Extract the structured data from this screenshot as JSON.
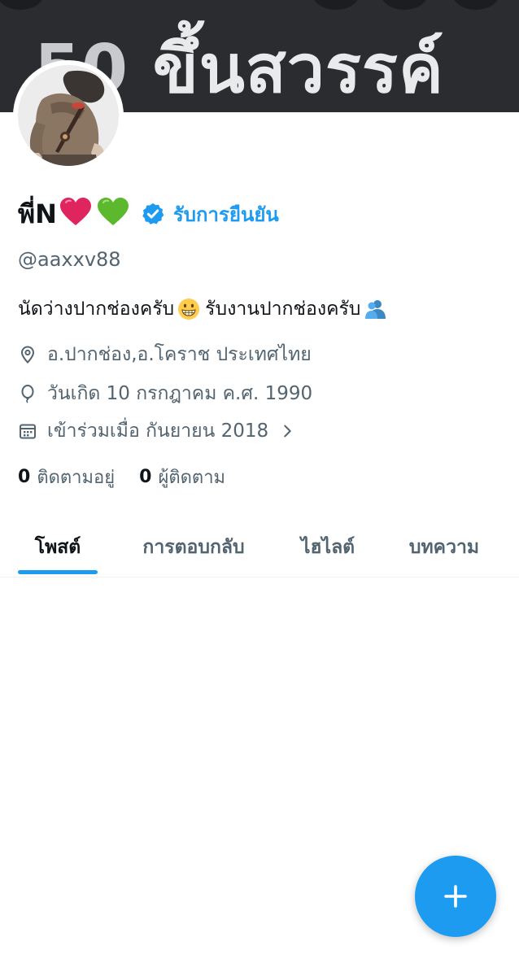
{
  "banner": {
    "number_text": "50",
    "text": "ขึ้นสวรรค์"
  },
  "profile": {
    "display_name": "พี่N",
    "heart_red_icon": "red-heart-emoji",
    "heart_green_icon": "green-heart-emoji",
    "verify_link": "รับการยืนยัน",
    "handle": "@aaxxv88",
    "bio_part1": "นัดว่างปากช่องครับ",
    "bio_emoji1": "grinning-face-emoji",
    "bio_part2": "รับงานปากช่องครับ",
    "bio_emoji2": "people-hugging-emoji",
    "location": "อ.ปากช่อง,อ.โคราช ประเทศไทย",
    "birthday": "วันเกิด 10 กรกฎาคม ค.ศ. 1990",
    "joined": "เข้าร่วมเมื่อ กันยายน 2018"
  },
  "stats": {
    "following_count": "0",
    "following_label": "ติดตามอยู่",
    "followers_count": "0",
    "followers_label": "ผู้ติดตาม"
  },
  "tabs": [
    {
      "label": "โพสต์",
      "active": true
    },
    {
      "label": "การตอบกลับ",
      "active": false
    },
    {
      "label": "ไฮไลต์",
      "active": false
    },
    {
      "label": "บทความ",
      "active": false
    }
  ],
  "colors": {
    "accent": "#1d9bf0",
    "text_primary": "#0f1419",
    "text_secondary": "#536471",
    "banner_bg": "#2a2c30"
  }
}
